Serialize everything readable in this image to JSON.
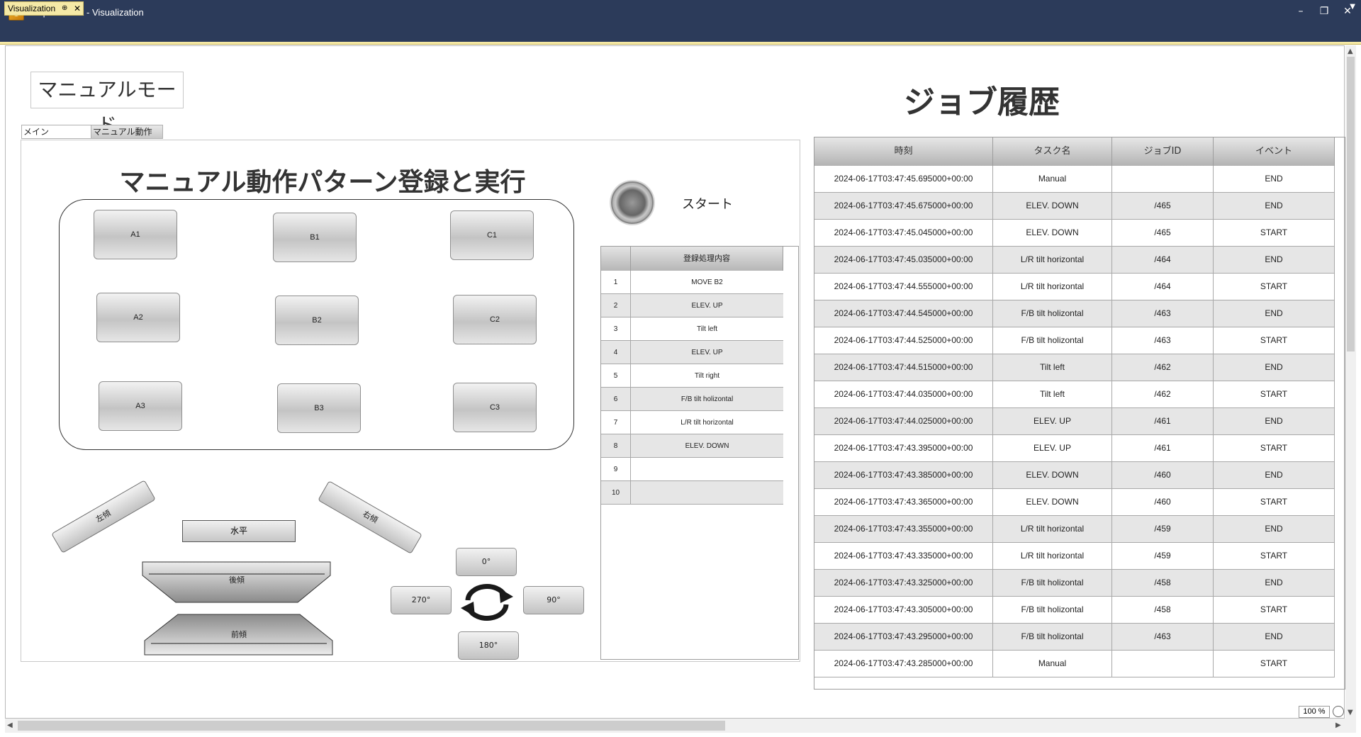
{
  "window": {
    "title": "CaptainDuck - Visualization",
    "minimize": "–",
    "restore": "❐",
    "close": "✕"
  },
  "doc_tab": {
    "label": "Visualization",
    "pin": "⊕",
    "close": "✕"
  },
  "mode": {
    "label": "マニュアルモード"
  },
  "tabs": [
    {
      "label": "メイン"
    },
    {
      "label": "マニュアル動作"
    }
  ],
  "panel": {
    "title": "マニュアル動作パターン登録と実行",
    "grid_buttons": [
      "A1",
      "B1",
      "C1",
      "A2",
      "B2",
      "C2",
      "A3",
      "B3",
      "C3"
    ],
    "start_label": "スタート",
    "reg_table": {
      "header": "登録処理内容",
      "rows": [
        {
          "no": "1",
          "content": "MOVE B2"
        },
        {
          "no": "2",
          "content": "ELEV. UP"
        },
        {
          "no": "3",
          "content": "Tilt left"
        },
        {
          "no": "4",
          "content": "ELEV. UP"
        },
        {
          "no": "5",
          "content": "Tilt right"
        },
        {
          "no": "6",
          "content": "F/B tilt holizontal"
        },
        {
          "no": "7",
          "content": "L/R tilt horizontal"
        },
        {
          "no": "8",
          "content": "ELEV. DOWN"
        },
        {
          "no": "9",
          "content": ""
        },
        {
          "no": "10",
          "content": ""
        }
      ]
    },
    "tilt": {
      "left": "左傾",
      "right": "右傾",
      "horizontal": "水平",
      "back": "後傾",
      "front": "前傾"
    },
    "rotation": {
      "r0": "0°",
      "r90": "90°",
      "r180": "180°",
      "r270": "270°"
    }
  },
  "job_history": {
    "title": "ジョブ履歴",
    "columns": [
      "時刻",
      "タスク名",
      "ジョブID",
      "イベント"
    ],
    "rows": [
      [
        "2024-06-17T03:47:45.695000+00:00",
        "Manual",
        "",
        "END"
      ],
      [
        "2024-06-17T03:47:45.675000+00:00",
        "ELEV. DOWN",
        "/465",
        "END"
      ],
      [
        "2024-06-17T03:47:45.045000+00:00",
        "ELEV. DOWN",
        "/465",
        "START"
      ],
      [
        "2024-06-17T03:47:45.035000+00:00",
        "L/R tilt horizontal",
        "/464",
        "END"
      ],
      [
        "2024-06-17T03:47:44.555000+00:00",
        "L/R tilt horizontal",
        "/464",
        "START"
      ],
      [
        "2024-06-17T03:47:44.545000+00:00",
        "F/B tilt holizontal",
        "/463",
        "END"
      ],
      [
        "2024-06-17T03:47:44.525000+00:00",
        "F/B tilt holizontal",
        "/463",
        "START"
      ],
      [
        "2024-06-17T03:47:44.515000+00:00",
        "Tilt left",
        "/462",
        "END"
      ],
      [
        "2024-06-17T03:47:44.035000+00:00",
        "Tilt left",
        "/462",
        "START"
      ],
      [
        "2024-06-17T03:47:44.025000+00:00",
        "ELEV. UP",
        "/461",
        "END"
      ],
      [
        "2024-06-17T03:47:43.395000+00:00",
        "ELEV. UP",
        "/461",
        "START"
      ],
      [
        "2024-06-17T03:47:43.385000+00:00",
        "ELEV. DOWN",
        "/460",
        "END"
      ],
      [
        "2024-06-17T03:47:43.365000+00:00",
        "ELEV. DOWN",
        "/460",
        "START"
      ],
      [
        "2024-06-17T03:47:43.355000+00:00",
        "L/R tilt horizontal",
        "/459",
        "END"
      ],
      [
        "2024-06-17T03:47:43.335000+00:00",
        "L/R tilt horizontal",
        "/459",
        "START"
      ],
      [
        "2024-06-17T03:47:43.325000+00:00",
        "F/B tilt holizontal",
        "/458",
        "END"
      ],
      [
        "2024-06-17T03:47:43.305000+00:00",
        "F/B tilt holizontal",
        "/458",
        "START"
      ],
      [
        "2024-06-17T03:47:43.295000+00:00",
        "F/B tilt holizontal",
        "/463",
        "END"
      ],
      [
        "2024-06-17T03:47:43.285000+00:00",
        "Manual",
        "",
        "START"
      ]
    ]
  },
  "statusbar": {
    "zoom": "100 %"
  }
}
